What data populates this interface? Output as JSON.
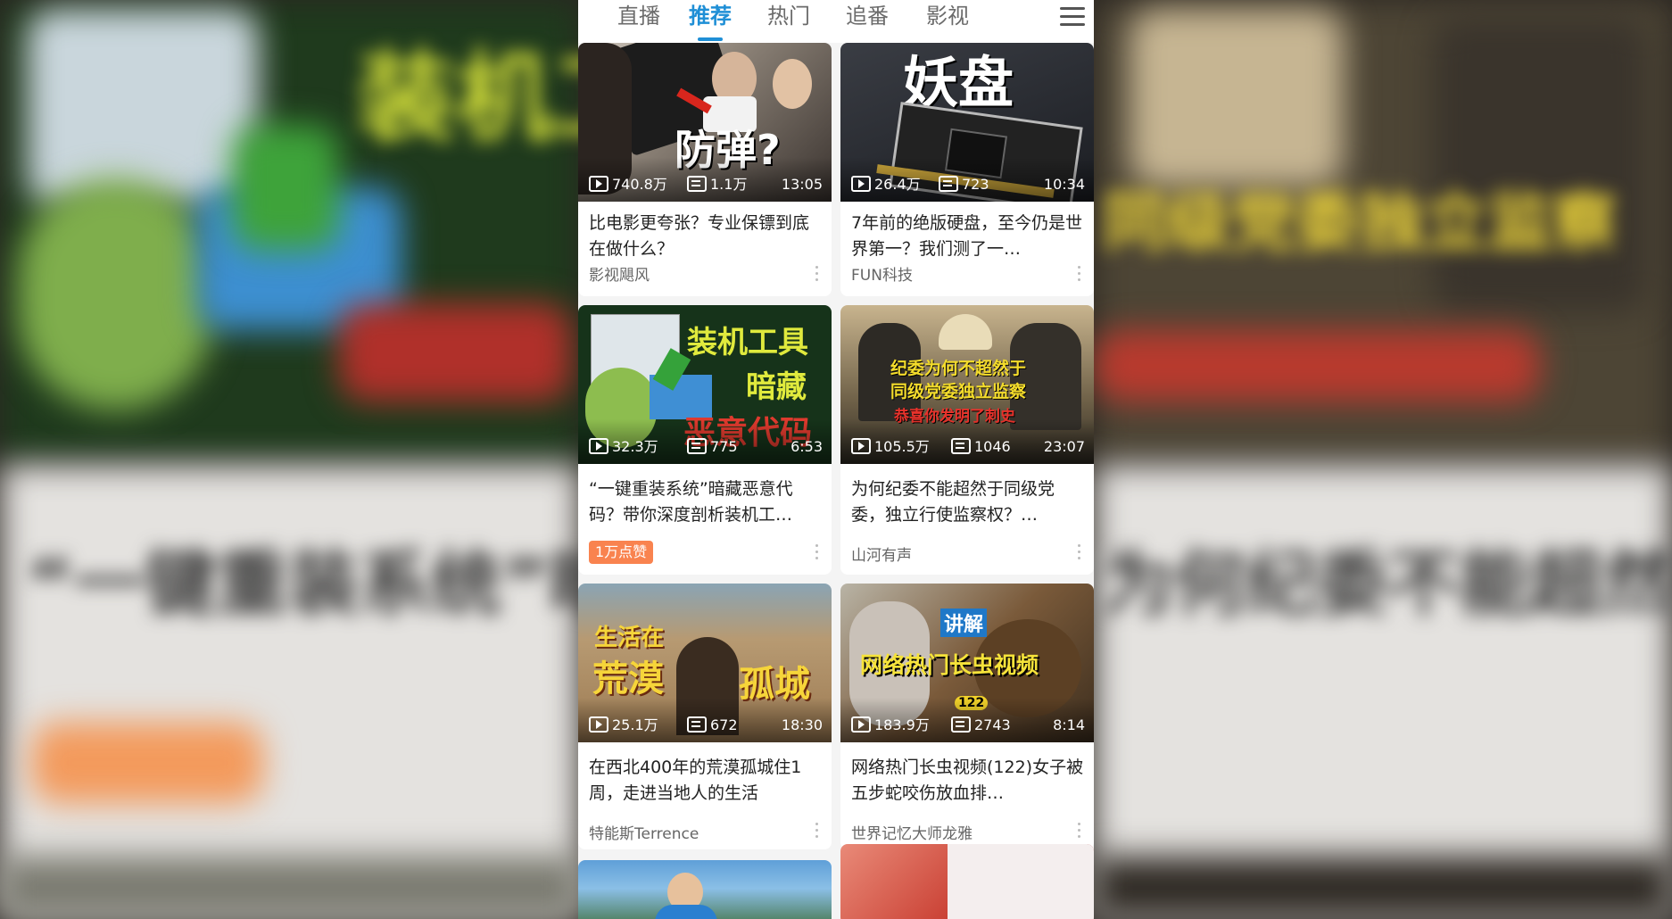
{
  "nav": {
    "tabs": [
      {
        "label": "直播"
      },
      {
        "label": "推荐"
      },
      {
        "label": "热门"
      },
      {
        "label": "追番"
      },
      {
        "label": "影视"
      }
    ],
    "active_tab": "推荐",
    "menu_icon": "menu-icon"
  },
  "colors": {
    "accent": "#1f8fd6",
    "badge": "#f9834f",
    "background": "#f4f4f4"
  },
  "videos": [
    {
      "views": "740.8万",
      "danmaku": "1.1万",
      "duration": "13:05",
      "thumb_text": "防弹?",
      "title": "比电影更夸张？专业保镖到底在做什么？",
      "author": "影视飓风"
    },
    {
      "views": "26.4万",
      "danmaku": "723",
      "duration": "10:34",
      "thumb_text": "妖盘",
      "title": "7年前的绝版硬盘，至今仍是世界第一？我们测了一…",
      "author": "FUN科技"
    },
    {
      "views": "32.3万",
      "danmaku": "775",
      "duration": "6:53",
      "thumb_text": [
        "装机工具",
        "暗藏",
        "恶意代码"
      ],
      "title": "“一键重装系统”暗藏恶意代码？带你深度剖析装机工…",
      "badge": "1万点赞"
    },
    {
      "views": "105.5万",
      "danmaku": "1046",
      "duration": "23:07",
      "thumb_text": [
        "纪委为何不超然于",
        "同级党委独立监察",
        "恭喜你发明了刺史"
      ],
      "title": "为何纪委不能超然于同级党委，独立行使监察权？…",
      "author": "山河有声"
    },
    {
      "views": "25.1万",
      "danmaku": "672",
      "duration": "18:30",
      "thumb_text": [
        "生活在",
        "荒漠",
        "孤城"
      ],
      "title": "在西北400年的荒漠孤城住1周，走进当地人的生活",
      "author": "特能斯Terrence"
    },
    {
      "views": "183.9万",
      "danmaku": "2743",
      "duration": "8:14",
      "thumb_text": [
        "讲解",
        "网络热门长虫视频",
        "122"
      ],
      "title": "网络热门长虫视频(122)女子被五步蛇咬伤放血排…",
      "author": "世界记忆大师龙雅"
    }
  ]
}
